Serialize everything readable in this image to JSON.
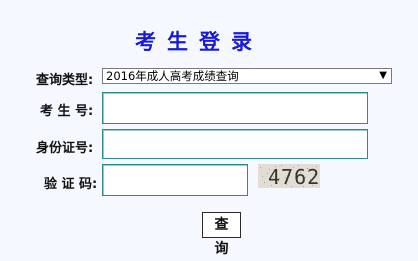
{
  "header": {
    "title": "考生登录"
  },
  "form": {
    "query_type_label": "查询类型:",
    "query_type_selected": "2016年成人高考成绩查询",
    "candidate_no_label": "考 生 号:",
    "candidate_no_value": "",
    "id_no_label": "身份证号:",
    "id_no_value": "",
    "captcha_label": "验 证 码:",
    "captcha_value": "",
    "captcha_code": "4762",
    "submit_label": "查 询"
  },
  "icons": {
    "select_arrow": "dropdown-arrow-icon"
  },
  "colors": {
    "title": "#1919d6",
    "background": "#f5f9ff",
    "input_border": "#2c8c8c"
  }
}
